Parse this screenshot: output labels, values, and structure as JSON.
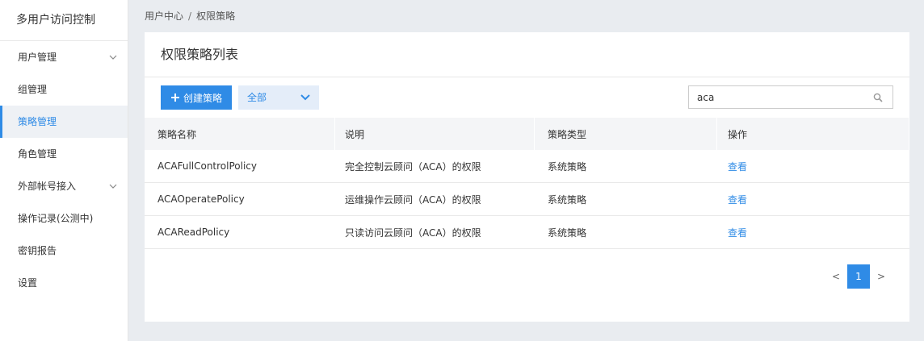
{
  "sidebar": {
    "title": "多用户访问控制",
    "items": [
      {
        "label": "用户管理"
      },
      {
        "label": "组管理"
      },
      {
        "label": "策略管理"
      },
      {
        "label": "角色管理"
      },
      {
        "label": "外部帐号接入"
      },
      {
        "label": "操作记录(公测中)"
      },
      {
        "label": "密钥报告"
      },
      {
        "label": "设置"
      }
    ]
  },
  "breadcrumb": {
    "root": "用户中心",
    "separator": "/",
    "current": "权限策略"
  },
  "main": {
    "title": "权限策略列表",
    "create_button": "创建策略",
    "filter_value": "全部",
    "search_value": "aca",
    "table": {
      "headers": [
        "策略名称",
        "说明",
        "策略类型",
        "操作"
      ],
      "rows": [
        {
          "name": "ACAFullControlPolicy",
          "desc": "完全控制云顾问（ACA）的权限",
          "type": "系统策略",
          "action": "查看"
        },
        {
          "name": "ACAOperatePolicy",
          "desc": "运维操作云顾问（ACA）的权限",
          "type": "系统策略",
          "action": "查看"
        },
        {
          "name": "ACAReadPolicy",
          "desc": "只读访问云顾问（ACA）的权限",
          "type": "系统策略",
          "action": "查看"
        }
      ]
    },
    "pagination": {
      "prev": "<",
      "current": "1",
      "next": ">"
    }
  },
  "colors": {
    "accent": "#2f8be6",
    "page_bg": "#e9ecf0",
    "filter_bg": "#e4edf9"
  }
}
